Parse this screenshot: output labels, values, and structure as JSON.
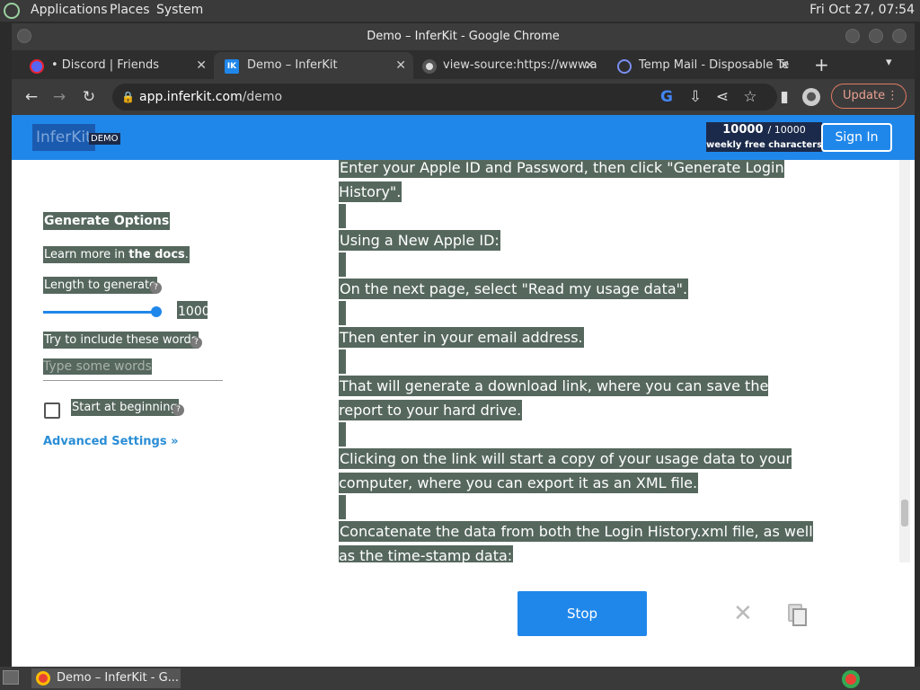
{
  "os": {
    "menus": [
      "Applications",
      "Places",
      "System"
    ],
    "clock": "Fri Oct 27, 07:54"
  },
  "window": {
    "title": "Demo – InferKit - Google Chrome"
  },
  "tabs": [
    {
      "label": "• Discord | Friends",
      "icon": "discord-icon",
      "active": false
    },
    {
      "label": "Demo – InferKit",
      "icon": "inferkit-icon",
      "active": true
    },
    {
      "label": "view-source:https://www.a",
      "icon": "view-source-icon",
      "active": false
    },
    {
      "label": "Temp Mail - Disposable Te",
      "icon": "tempmail-icon",
      "active": false
    }
  ],
  "toolbar": {
    "url_host": "app.inferkit.com",
    "url_path": "/demo",
    "update_label": "Update"
  },
  "site": {
    "logo": "InferKit",
    "logo_badge": "DEMO",
    "quota_used": "10000",
    "quota_total": "/ 10000",
    "quota_caption": "weekly free characters",
    "signin_label": "Sign In"
  },
  "options": {
    "title": "Generate Options",
    "docs_prefix": "Learn more in ",
    "docs_link": "the docs",
    "docs_suffix": ".",
    "length_label": "Length to generate",
    "length_value": "1000",
    "slider_fraction": 1.0,
    "words_label": "Try to include these words",
    "words_placeholder": "Type some words",
    "start_label": "Start at beginning",
    "advanced_label": "Advanced Settings »"
  },
  "output": {
    "lines": [
      "Enter your Apple ID and Password, then click \"Generate Login History\".",
      "",
      "Using a New Apple ID:",
      "",
      "On the next page, select \"Read my usage data\".",
      "",
      "Then enter in your email address.",
      "",
      "That will generate a download link, where you can save the report to your hard drive.",
      "",
      "Clicking on the link will start a copy of your usage data to your computer, where you can export it as an XML file.",
      "",
      "Concatenate the data from both the Login History.xml file, as well as the time-stamp data:"
    ],
    "stop_label": "Stop"
  },
  "taskbar": {
    "item_label": "Demo – InferKit - G..."
  },
  "colors": {
    "brand_blue": "#2087ea",
    "highlight": "#56685e",
    "update_border": "#e07b64"
  }
}
